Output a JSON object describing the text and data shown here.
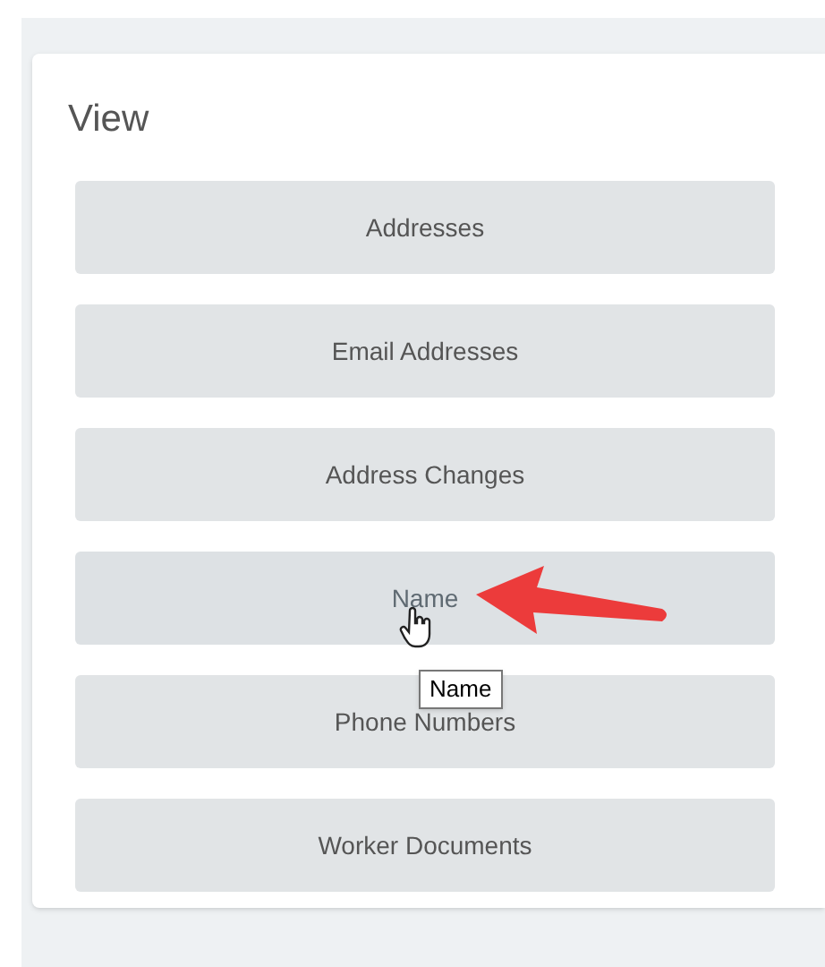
{
  "panel": {
    "title": "View",
    "buttons": [
      {
        "label": "Addresses",
        "hovered": false
      },
      {
        "label": "Email Addresses",
        "hovered": false
      },
      {
        "label": "Address Changes",
        "hovered": false
      },
      {
        "label": "Name",
        "hovered": true,
        "tooltip": "Name"
      },
      {
        "label": "Phone Numbers",
        "hovered": false
      },
      {
        "label": "Worker Documents",
        "hovered": false
      }
    ]
  }
}
